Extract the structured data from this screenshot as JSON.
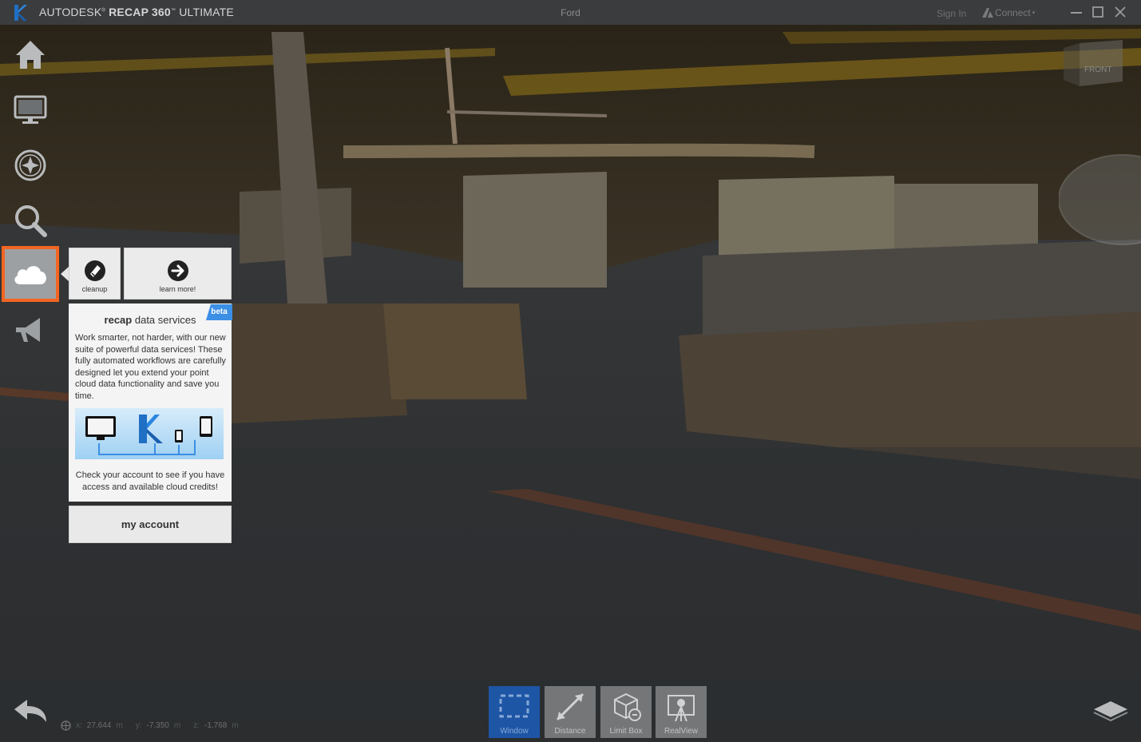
{
  "titlebar": {
    "brand_light": "AUTODESK",
    "brand_bold": "RECAP 360",
    "brand_suffix": "ULTIMATE",
    "document": "Ford",
    "sign_in": "Sign In",
    "connect": "Connect"
  },
  "rail": {
    "icons": [
      "home-icon",
      "monitor-icon",
      "compass-icon",
      "search-icon",
      "cloud-icon",
      "announcement-icon"
    ],
    "active": "cloud-icon",
    "active_color": "#f26522"
  },
  "flyout": {
    "cleanup_label": "cleanup",
    "learn_more_label": "learn more!",
    "badge": "beta",
    "title_bold": "recap",
    "title_rest": "data services",
    "body": "Work smarter, not harder, with our new suite of powerful data services! These fully automated workflows are carefully designed let you  extend your point cloud data functionality and save you time.",
    "footer": "Check your account to see if you have access and available cloud credits!",
    "account_button": "my account"
  },
  "coords": {
    "x_label": "x:",
    "x": "27.644",
    "x_unit": "m",
    "y_label": "y:",
    "y": "-7.350",
    "y_unit": "m",
    "z_label": "z:",
    "z": "-1.768",
    "z_unit": "m"
  },
  "toolbar": {
    "tools": [
      {
        "label": "Window",
        "icon": "window-select-icon",
        "active": true
      },
      {
        "label": "Distance",
        "icon": "distance-icon",
        "active": false
      },
      {
        "label": "Limit Box",
        "icon": "limit-box-icon",
        "active": false
      },
      {
        "label": "RealView",
        "icon": "realview-icon",
        "active": false
      }
    ]
  },
  "viewcube": {
    "face": "FRONT"
  },
  "colors": {
    "accent": "#f26522",
    "active_tool": "#1d5ab0",
    "beta": "#3b8fe5"
  }
}
